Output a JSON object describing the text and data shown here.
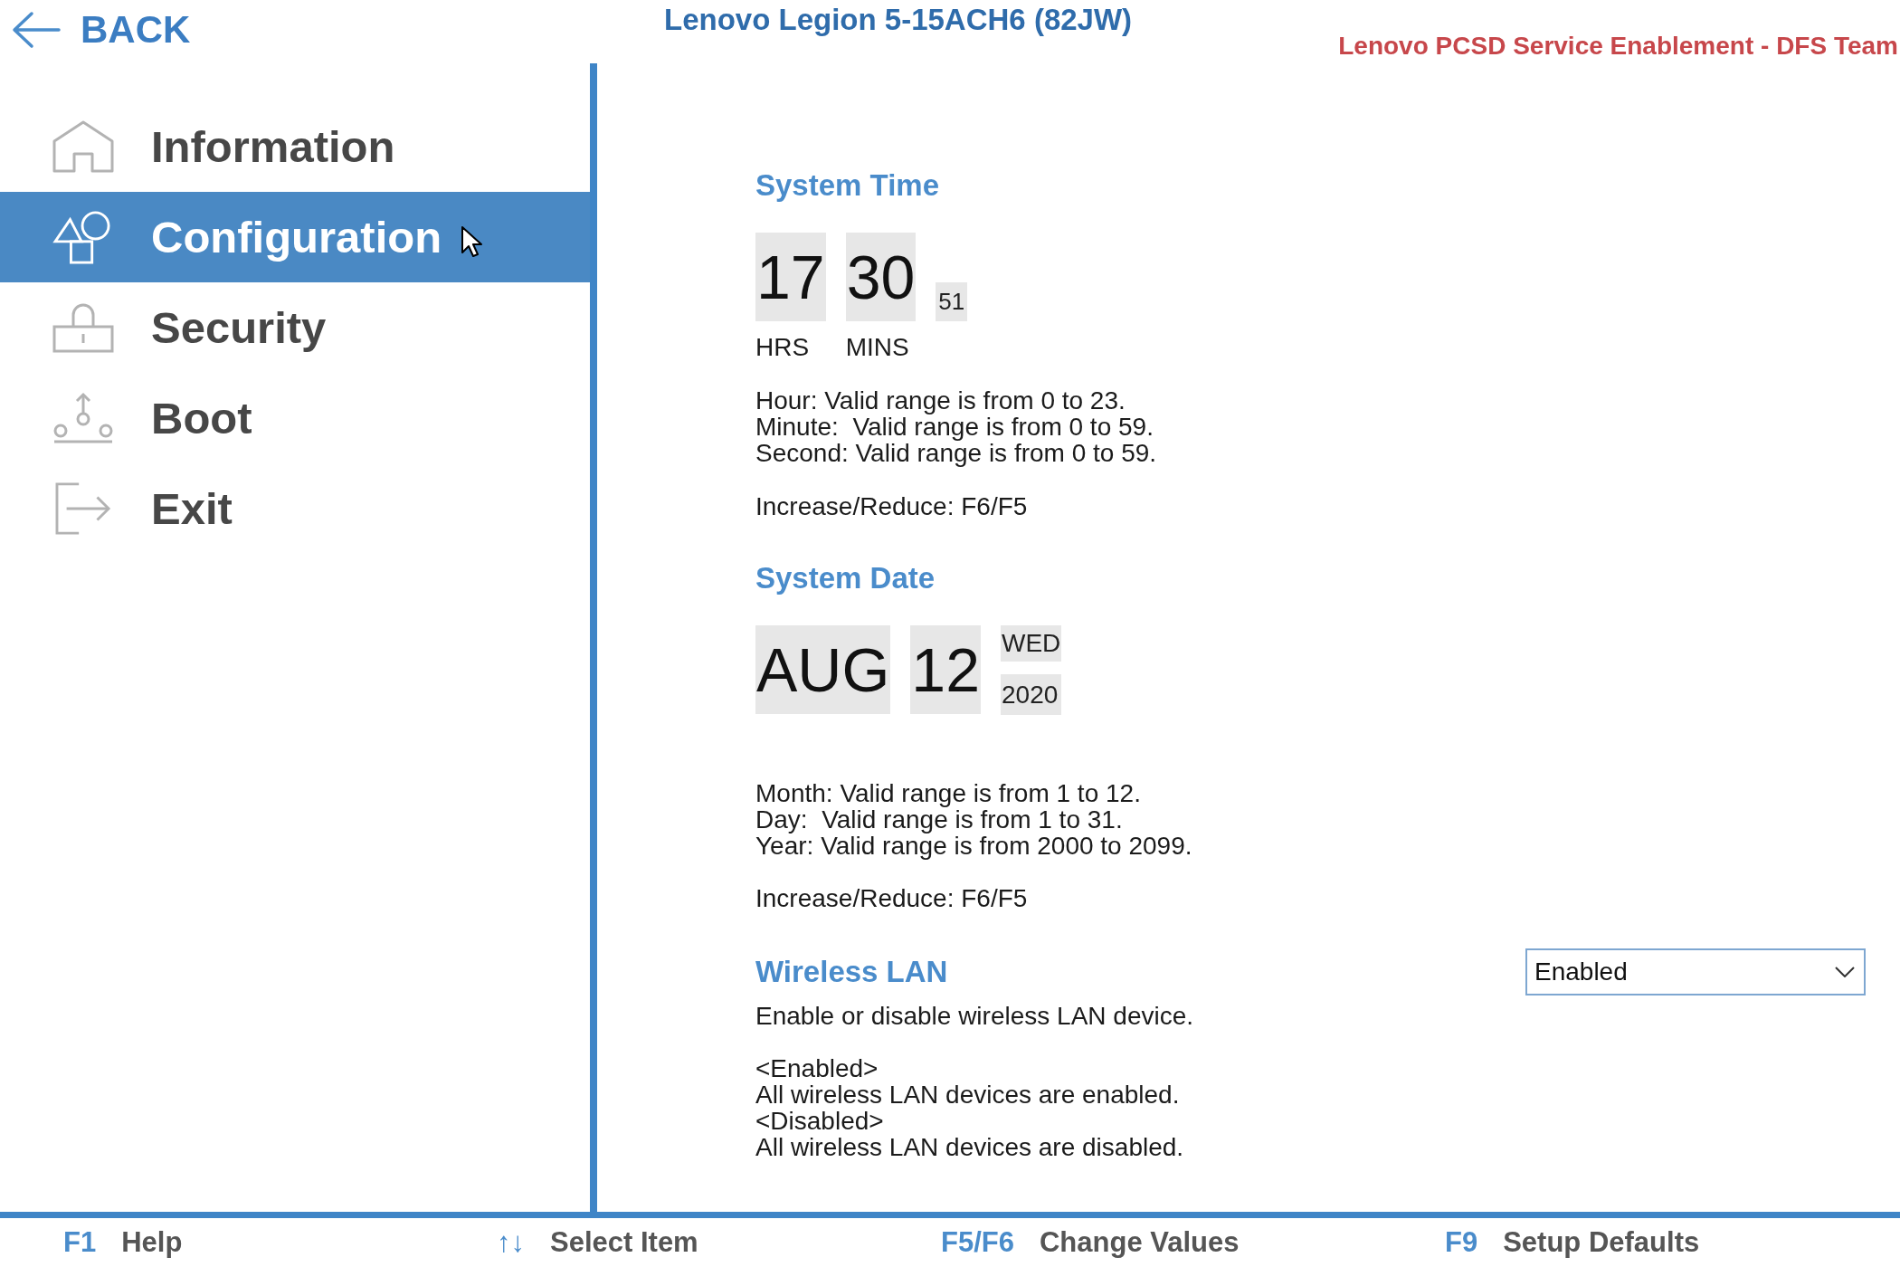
{
  "header": {
    "back_label": "BACK",
    "title": "Lenovo Legion 5-15ACH6 (82JW)",
    "team_label": "Lenovo PCSD Service Enablement - DFS Team"
  },
  "sidebar": {
    "items": [
      {
        "label": "Information",
        "selected": false
      },
      {
        "label": "Configuration",
        "selected": true
      },
      {
        "label": "Security",
        "selected": false
      },
      {
        "label": "Boot",
        "selected": false
      },
      {
        "label": "Exit",
        "selected": false
      }
    ]
  },
  "system_time": {
    "heading": "System Time",
    "hours": "17",
    "minutes": "30",
    "seconds": "51",
    "hours_label": "HRS",
    "minutes_label": "MINS",
    "help": [
      "Hour: Valid range is from 0 to 23.",
      "Minute:  Valid range is from 0 to 59.",
      "Second: Valid range is from 0 to 59."
    ],
    "keys_hint": "Increase/Reduce: F6/F5"
  },
  "system_date": {
    "heading": "System Date",
    "month": "AUG",
    "day": "12",
    "weekday": "WED",
    "year": "2020",
    "help": [
      "Month: Valid range is from 1 to 12.",
      "Day:  Valid range is from 1 to 31.",
      "Year: Valid range is from 2000 to 2099."
    ],
    "keys_hint": "Increase/Reduce: F6/F5"
  },
  "wireless_lan": {
    "heading": "Wireless LAN",
    "dropdown": {
      "value": "Enabled"
    },
    "description": "Enable or disable wireless LAN device.",
    "details": [
      "<Enabled>",
      "All wireless LAN devices are enabled.",
      "<Disabled>",
      "All wireless LAN devices are disabled."
    ]
  },
  "footer": {
    "shortcuts": [
      {
        "key": "F1",
        "action": "Help"
      },
      {
        "key": "↑↓",
        "action": "Select Item"
      },
      {
        "key": "F5/F6",
        "action": "Change Values"
      },
      {
        "key": "F9",
        "action": "Setup Defaults"
      }
    ]
  }
}
